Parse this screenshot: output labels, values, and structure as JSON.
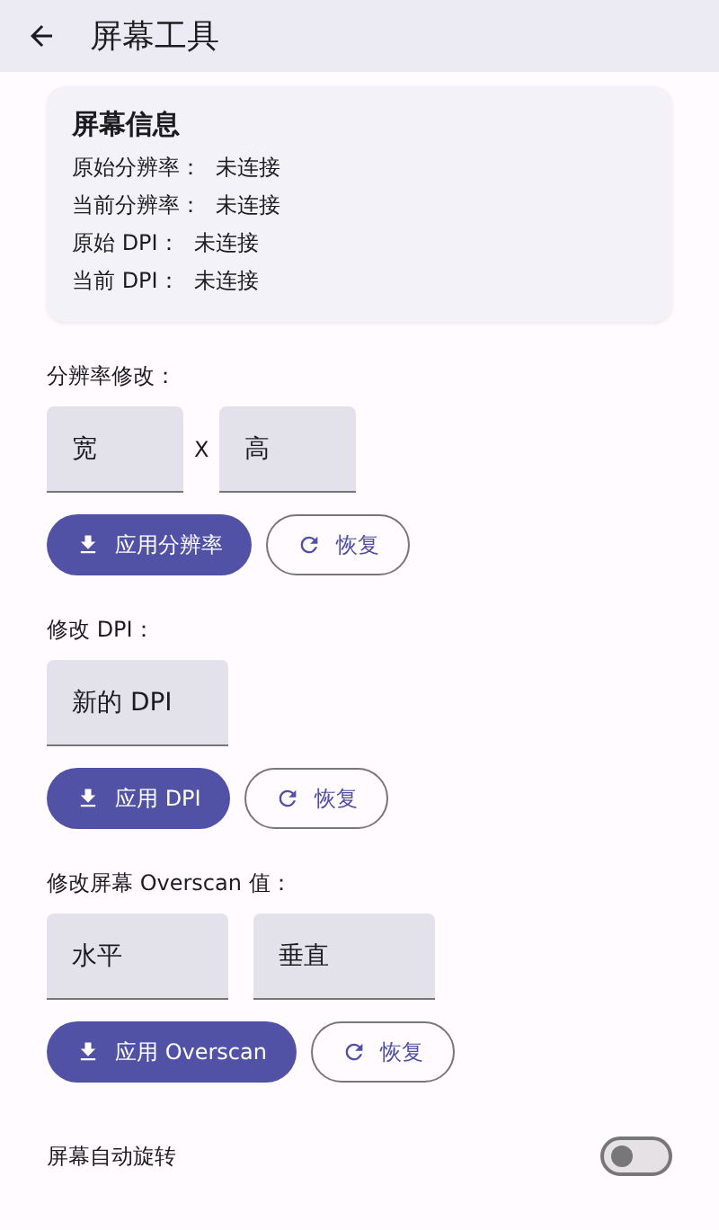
{
  "app_bar": {
    "title": "屏幕工具"
  },
  "info_card": {
    "title": "屏幕信息",
    "rows": [
      {
        "label": "原始分辨率：",
        "value": "未连接"
      },
      {
        "label": "当前分辨率：",
        "value": "未连接"
      },
      {
        "label": "原始 DPI：",
        "value": "未连接"
      },
      {
        "label": "当前 DPI：",
        "value": "未连接"
      }
    ]
  },
  "sections": [
    {
      "label": "分辨率修改：",
      "fields": [
        {
          "placeholder": "宽"
        },
        {
          "placeholder": "高"
        }
      ],
      "separator": "X",
      "apply_button": "应用分辨率",
      "reset_button": "恢复"
    },
    {
      "label": "修改 DPI：",
      "fields": [
        {
          "placeholder": "新的 DPI"
        }
      ],
      "apply_button": "应用 DPI",
      "reset_button": "恢复"
    },
    {
      "label": "修改屏幕 Overscan 值：",
      "fields": [
        {
          "placeholder": "水平"
        },
        {
          "placeholder": "垂直"
        }
      ],
      "apply_button": "应用 Overscan",
      "reset_button": "恢复"
    }
  ],
  "auto_rotate": {
    "label": "屏幕自动旋转",
    "on": false
  }
}
